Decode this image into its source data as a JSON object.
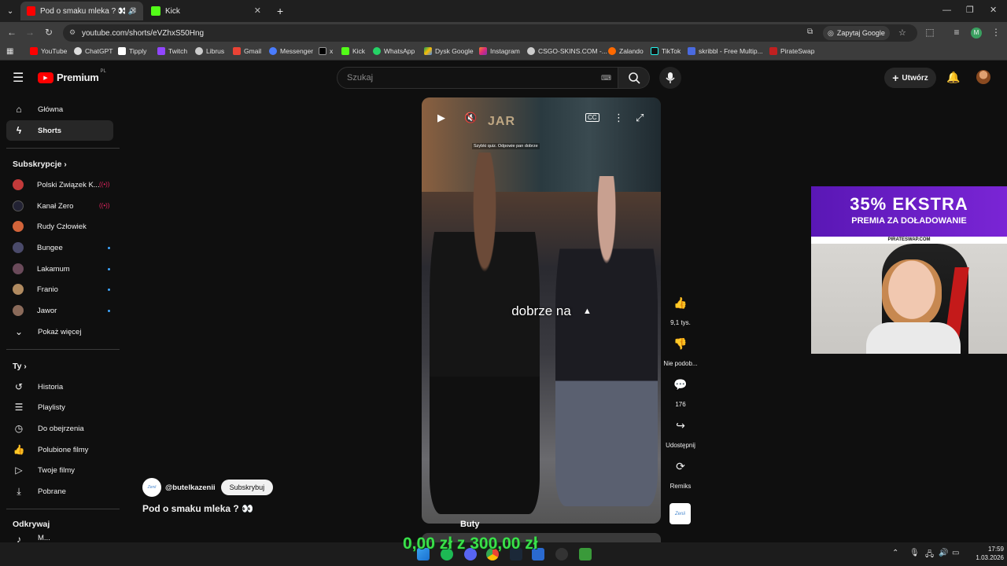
{
  "browser": {
    "tabs": [
      {
        "label": "Pod o smaku mleka ? 👀 -",
        "active": true
      },
      {
        "label": "Kick",
        "active": false
      }
    ],
    "url": "youtube.com/shorts/eVZhxS50Hng",
    "ask_google": "Zapytaj Google",
    "bookmarks": [
      "YouTube",
      "ChatGPT",
      "Tipply",
      "Twitch",
      "Librus",
      "Gmail",
      "Messenger",
      "x",
      "Kick",
      "WhatsApp",
      "Dysk Google",
      "Instagram",
      "CSGO-SKINS.COM -...",
      "Zalando",
      "TikTok",
      "skribbl - Free Multip...",
      "PirateSwap"
    ]
  },
  "yt": {
    "logo": "Premium",
    "logo_sup": "PL",
    "search_placeholder": "Szukaj",
    "create_label": "Utwórz"
  },
  "sidebar": {
    "main": [
      {
        "label": "Główna",
        "icon": "home-icon"
      },
      {
        "label": "Shorts",
        "icon": "shorts-icon",
        "active": true
      }
    ],
    "subs_title": "Subskrypcje",
    "subs": [
      {
        "label": "Polski Związek K...",
        "color": "#c23a3a",
        "live": true
      },
      {
        "label": "Kanał Zero",
        "color": "#222233",
        "live": true
      },
      {
        "label": "Rudy Człowiek",
        "color": "#d2643a"
      },
      {
        "label": "Bungee",
        "color": "#4a4a6a",
        "dot": true
      },
      {
        "label": "Lakamum",
        "color": "#6a4a5a",
        "dot": true
      },
      {
        "label": "Franio",
        "color": "#b08a60",
        "dot": true
      },
      {
        "label": "Jawor",
        "color": "#8a6a5a",
        "dot": true
      }
    ],
    "show_more": "Pokaż więcej",
    "you_title": "Ty",
    "you": [
      {
        "label": "Historia",
        "icon": "history-icon"
      },
      {
        "label": "Playlisty",
        "icon": "playlist-icon"
      },
      {
        "label": "Do obejrzenia",
        "icon": "watch-later-icon"
      },
      {
        "label": "Polubione filmy",
        "icon": "like-icon"
      },
      {
        "label": "Twoje filmy",
        "icon": "video-icon"
      },
      {
        "label": "Pobrane",
        "icon": "download-icon"
      }
    ],
    "explore_title": "Odkrywaj",
    "explore_partial": "M..."
  },
  "video": {
    "caption": "dobrze na",
    "small_text": "Szybki quiz. Odpowie pan dobrze",
    "below_label": "Buty",
    "neon_sign": "JAR"
  },
  "actions": {
    "likes": "9,1 tys.",
    "dislike": "Nie podob...",
    "comments": "176",
    "share": "Udostępnij",
    "remix": "Remiks"
  },
  "channel": {
    "handle": "@butelkazenii",
    "subscribe": "Subskrybuj",
    "title": "Pod o smaku mleka ? 👀",
    "avatar_text": "Zenii"
  },
  "ad": {
    "headline": "35% EKSTRA",
    "sub": "PREMIA ZA DOŁADOWANIE",
    "domain": "PIRATESWAP.COM"
  },
  "overlay_text": "0,00 zł z 300,00 zł",
  "taskbar": {
    "time": "17:59",
    "date": "1.03.2026"
  }
}
